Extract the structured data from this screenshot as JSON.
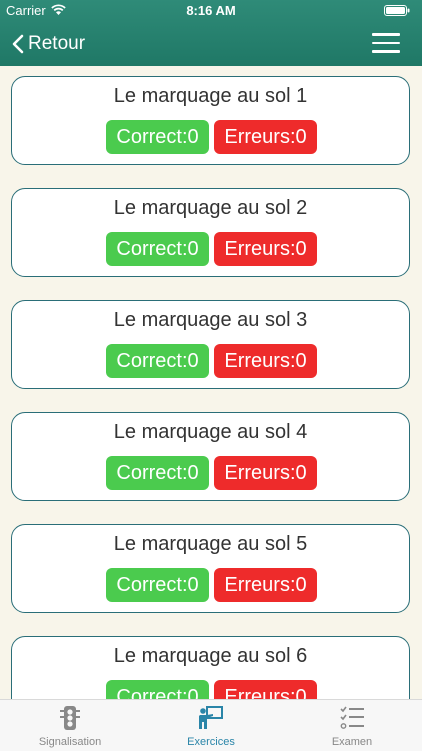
{
  "status": {
    "carrier": "Carrier",
    "time": "8:16 AM"
  },
  "nav": {
    "back_label": "Retour"
  },
  "items": [
    {
      "title": "Le marquage au sol 1",
      "correct": "Correct:0",
      "errors": "Erreurs:0"
    },
    {
      "title": "Le marquage au sol 2",
      "correct": "Correct:0",
      "errors": "Erreurs:0"
    },
    {
      "title": "Le marquage au sol 3",
      "correct": "Correct:0",
      "errors": "Erreurs:0"
    },
    {
      "title": "Le marquage au sol 4",
      "correct": "Correct:0",
      "errors": "Erreurs:0"
    },
    {
      "title": "Le marquage au sol 5",
      "correct": "Correct:0",
      "errors": "Erreurs:0"
    },
    {
      "title": "Le marquage au sol 6",
      "correct": "Correct:0",
      "errors": "Erreurs:0"
    }
  ],
  "tabs": [
    {
      "label": "Signalisation",
      "icon": "traffic-light-icon"
    },
    {
      "label": "Exercices",
      "icon": "teacher-board-icon",
      "active": true
    },
    {
      "label": "Examen",
      "icon": "checklist-icon"
    }
  ],
  "colors": {
    "header": "#1f7866",
    "correct": "#4bcb4e",
    "errors": "#ee2b2b",
    "active_tab": "#2a85a8"
  }
}
